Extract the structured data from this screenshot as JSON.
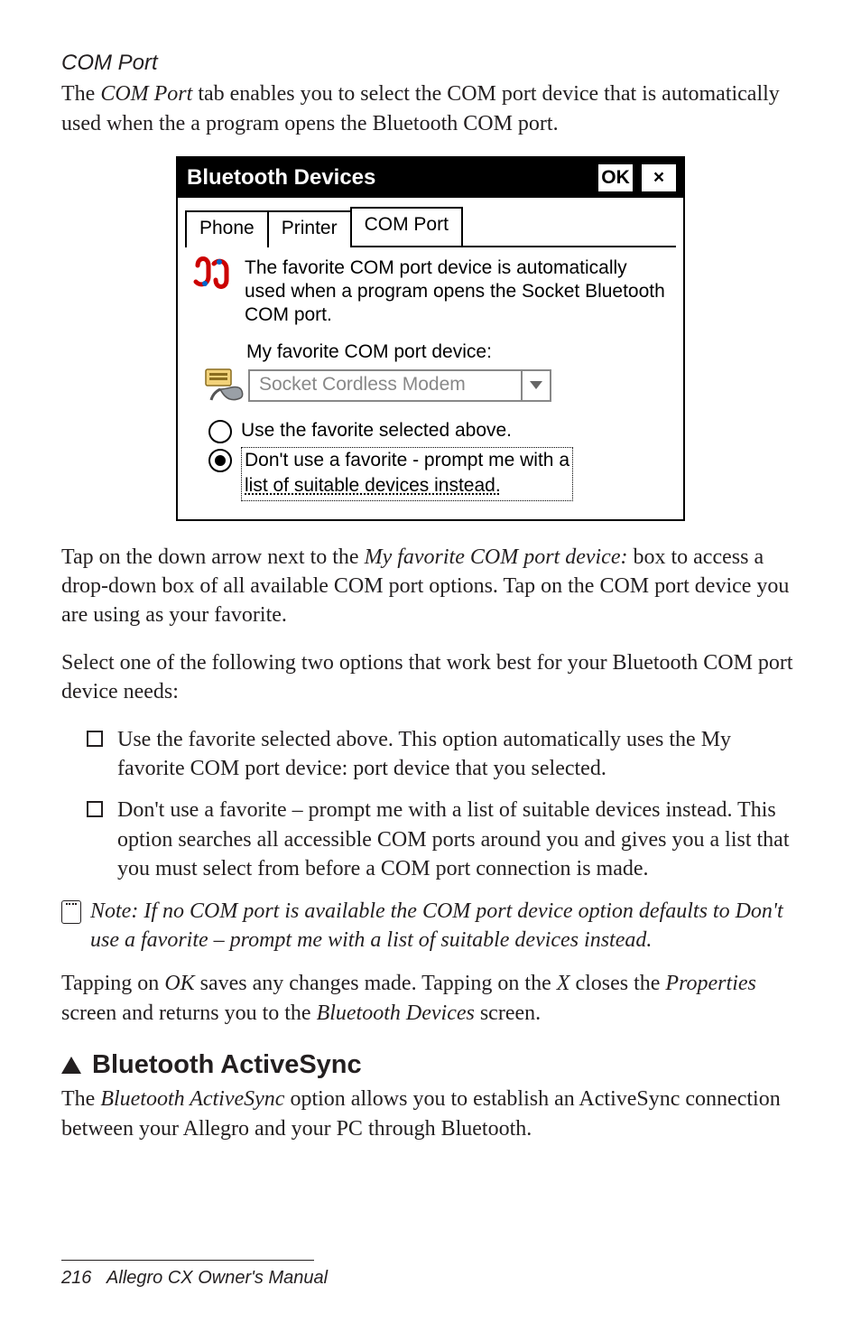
{
  "section_title": "COM Port",
  "intro": {
    "t1": "The ",
    "t2": "COM Port",
    "t3": " tab enables you to select the COM port device that is automatically used when the a program opens the Bluetooth COM port."
  },
  "dialog": {
    "title": "Bluetooth Devices",
    "ok": "OK",
    "close": "×",
    "tabs": {
      "phone": "Phone",
      "printer": "Printer",
      "com": "COM Port"
    },
    "info": "The favorite COM port device is automatically used when a program opens the Socket Bluetooth COM port.",
    "field_label": "My favorite COM port device:",
    "combo_value": "Socket Cordless Modem",
    "radio1": "Use the favorite selected above.",
    "radio2a": "Don't use a favorite - prompt me with a",
    "radio2b": "list of suitable devices instead."
  },
  "para_after1": {
    "a": "Tap on the down arrow next to the ",
    "b": "My favorite COM port device:",
    "c": " box to access a drop-down box of all available COM port options. Tap on the COM port device you are using as your favorite."
  },
  "para_after2": "Select one of the following two options that work best for your Bluetooth COM port device needs:",
  "bullets": {
    "b1": "Use the favorite selected above. This option automatically uses the My favorite COM port device: port device that you selected.",
    "b2": "Don't use a favorite – prompt me with a list of suitable devices instead. This option searches all accessible COM ports around you and gives you a list that you must select from before a COM port connection is made."
  },
  "note": "Note: If no COM port is available the COM port device option defaults to Don't use a favorite – prompt me with a list of suitable devices instead.",
  "para_after3": {
    "a": "Tapping on ",
    "b": "OK",
    "c": " saves any changes made. Tapping on the ",
    "d": "X",
    "e": " closes the ",
    "f": "Properties",
    "g": " screen and returns you to the ",
    "h": "Bluetooth Devices",
    "i": " screen."
  },
  "heading2": "Bluetooth ActiveSync",
  "para_bt": {
    "a": "The ",
    "b": "Bluetooth ActiveSync",
    "c": " option allows you to establish an ActiveSync connection between your Allegro and your PC through Bluetooth."
  },
  "footer": {
    "page": "216",
    "title": "Allegro CX Owner's Manual"
  }
}
